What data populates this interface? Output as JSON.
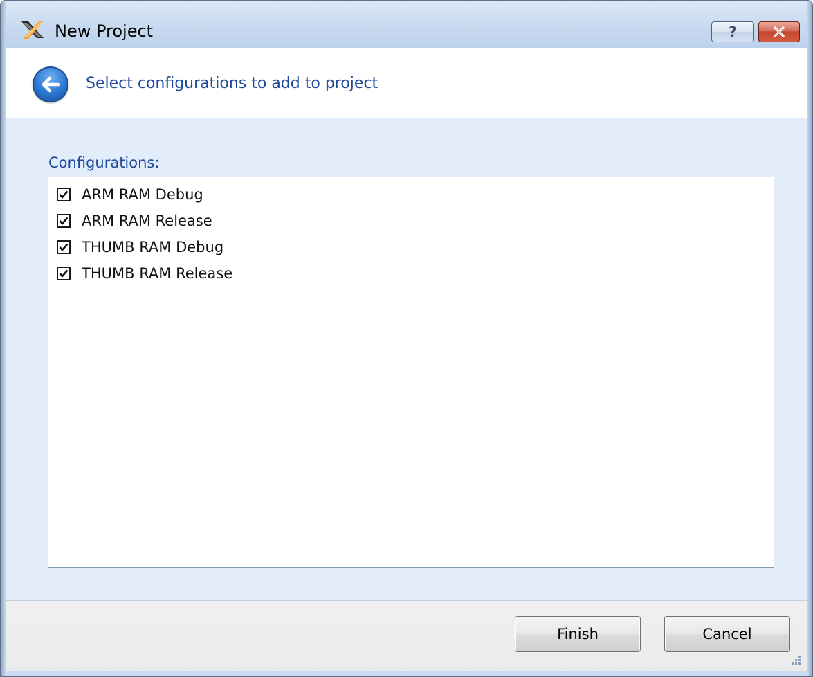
{
  "window": {
    "title": "New Project",
    "help_label": "?",
    "close_label": "x"
  },
  "header": {
    "heading": "Select configurations to add to project"
  },
  "configurations": {
    "label": "Configurations:",
    "items": [
      {
        "label": "ARM RAM Debug",
        "checked": true
      },
      {
        "label": "ARM RAM Release",
        "checked": true
      },
      {
        "label": "THUMB RAM Debug",
        "checked": true
      },
      {
        "label": "THUMB RAM Release",
        "checked": true
      }
    ]
  },
  "footer": {
    "finish_label": "Finish",
    "cancel_label": "Cancel"
  },
  "colors": {
    "heading_text": "#1e4a9b",
    "content_background": "#e3ecfa",
    "close_button": "#c4462e"
  },
  "icons": {
    "app": "crossed-tools-icon",
    "back": "back-arrow-icon",
    "check": "checkmark-icon",
    "resize": "resize-grip-icon"
  }
}
